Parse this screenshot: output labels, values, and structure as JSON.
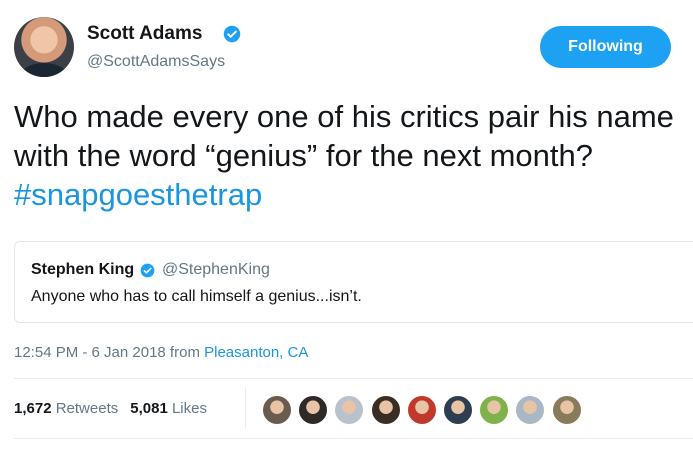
{
  "author": {
    "display_name": "Scott Adams",
    "handle": "@ScottAdamsSays",
    "verified": true
  },
  "follow_button": {
    "label": "Following"
  },
  "tweet": {
    "text": "Who made every one of his critics pair his name with the word “genius” for the next month? ",
    "hashtag": "#snapgoesthetrap"
  },
  "quoted_tweet": {
    "display_name": "Stephen King",
    "handle": "@StephenKing",
    "verified": true,
    "text": "Anyone who has to call himself a genius...isn’t."
  },
  "meta": {
    "time": "12:54 PM - 6 Jan 2018 from ",
    "location": "Pleasanton, CA"
  },
  "stats": {
    "retweets_count": "1,672",
    "retweets_label": "Retweets",
    "likes_count": "5,081",
    "likes_label": "Likes"
  },
  "likers": [
    {
      "color": "#6b5a4e"
    },
    {
      "color": "#2f2a28"
    },
    {
      "color": "#b8c2cc"
    },
    {
      "color": "#3a2e24"
    },
    {
      "color": "#c0392b"
    },
    {
      "color": "#2c3e50"
    },
    {
      "color": "#7fb24a"
    },
    {
      "color": "#a9b7c6"
    },
    {
      "color": "#8a7a5c"
    }
  ],
  "colors": {
    "accent": "#1da1f2",
    "link": "#1b95e0",
    "secondary_text": "#657786"
  }
}
